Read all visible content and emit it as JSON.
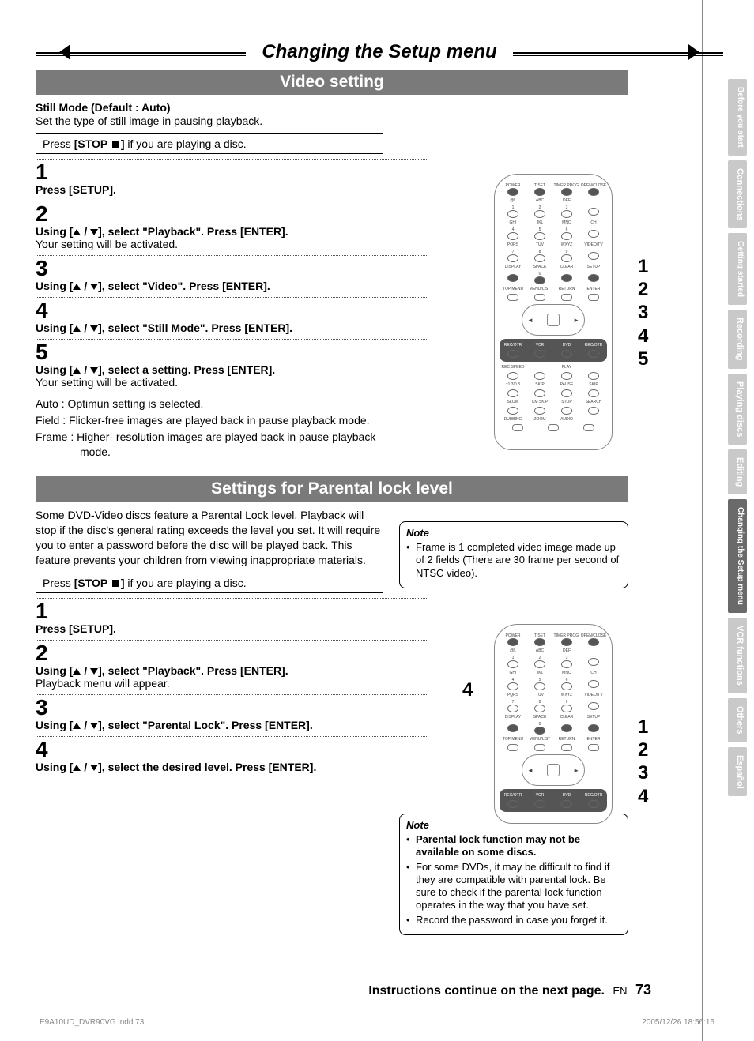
{
  "banner_title": "Changing the Setup menu",
  "section1": {
    "title": "Video setting",
    "heading": "Still Mode (Default : Auto)",
    "desc": "Set the type of still image in pausing playback.",
    "box_pre": "Press ",
    "box_bold": "[STOP ",
    "box_post": " if you are playing a disc.",
    "box_bold_close": "]",
    "steps": [
      {
        "num": "1",
        "bold": "Press [SETUP].",
        "rest": ""
      },
      {
        "num": "2",
        "bold_prefix": "Using [",
        "bold_mid": " / ",
        "bold_suffix": "], select \"Playback\". Press [ENTER].",
        "rest": "Your setting will be activated."
      },
      {
        "num": "3",
        "bold_prefix": "Using [",
        "bold_mid": " / ",
        "bold_suffix": "], select \"Video\". Press [ENTER].",
        "rest": ""
      },
      {
        "num": "4",
        "bold_prefix": "Using [",
        "bold_mid": " / ",
        "bold_suffix": "], select \"Still Mode\". Press [ENTER].",
        "rest": ""
      },
      {
        "num": "5",
        "bold_prefix": "Using [",
        "bold_mid": " / ",
        "bold_suffix": "], select a setting. Press [ENTER].",
        "rest": "Your setting will be activated."
      }
    ],
    "options": [
      "Auto : Optimun setting is selected.",
      "Field : Flicker-free images are played back in pause playback mode.",
      "Frame : Higher- resolution images are played back in pause playback mode."
    ],
    "callouts": [
      "1",
      "2",
      "3",
      "4",
      "5"
    ],
    "note_title": "Note",
    "note_items": [
      "Frame is 1 completed video image made up of 2 fields (There are 30 frame per second of NTSC video)."
    ]
  },
  "section2": {
    "title": "Settings for Parental lock level",
    "intro": "Some DVD-Video discs feature a Parental Lock level. Playback will stop if the disc's general rating exceeds the level you set. It will require you to enter a password before the disc will be played back. This feature prevents your children from viewing inappropriate materials.",
    "box_pre": "Press ",
    "box_bold": "[STOP ",
    "box_bold_close": "]",
    "box_post": " if you are playing a disc.",
    "steps": [
      {
        "num": "1",
        "bold": "Press [SETUP].",
        "rest": ""
      },
      {
        "num": "2",
        "bold_prefix": "Using [",
        "bold_mid": " / ",
        "bold_suffix": "], select \"Playback\". Press [ENTER].",
        "rest": "Playback menu will appear."
      },
      {
        "num": "3",
        "bold_prefix": "Using [",
        "bold_mid": " / ",
        "bold_suffix": "], select \"Parental Lock\". Press [ENTER].",
        "rest": ""
      },
      {
        "num": "4",
        "bold_prefix": "Using [",
        "bold_mid": " / ",
        "bold_suffix": "], select the desired level. Press [ENTER].",
        "rest": ""
      }
    ],
    "callout_left": "4",
    "callouts": [
      "1",
      "2",
      "3",
      "4"
    ],
    "note_title": "Note",
    "note_items": [
      {
        "bold": true,
        "text": "Parental lock function may not be available on some discs."
      },
      {
        "bold": false,
        "text": "For some DVDs, it may be difficult to find if they are compatible with parental lock. Be sure to check if the parental lock function operates in the way that you have set."
      },
      {
        "bold": false,
        "text": "Record the password in case you forget it."
      }
    ]
  },
  "tabs": [
    {
      "label": "Before you start",
      "active": false
    },
    {
      "label": "Connections",
      "active": false
    },
    {
      "label": "Getting started",
      "active": false
    },
    {
      "label": "Recording",
      "active": false
    },
    {
      "label": "Playing discs",
      "active": false
    },
    {
      "label": "Editing",
      "active": false
    },
    {
      "label": "Changing the Setup menu",
      "active": true
    },
    {
      "label": "VCR functions",
      "active": false
    },
    {
      "label": "Others",
      "active": false
    },
    {
      "label": "Español",
      "active": false
    }
  ],
  "remote_labels": {
    "row0": [
      "POWER",
      "T-SET",
      "TIMER PROG.",
      "OPEN/CLOSE"
    ],
    "row1": [
      "@!.",
      "ABC",
      "DEF",
      ""
    ],
    "row1n": [
      "1",
      "2",
      "3",
      ""
    ],
    "row2": [
      "GHI",
      "JKL",
      "MNO",
      "CH"
    ],
    "row2n": [
      "4",
      "5",
      "6",
      ""
    ],
    "row3": [
      "PQRS",
      "TUV",
      "WXYZ",
      "VIDEO/TV"
    ],
    "row3n": [
      "7",
      "8",
      "9",
      ""
    ],
    "row4": [
      "DISPLAY",
      "SPACE",
      "CLEAR",
      "SETUP"
    ],
    "row4n": [
      "",
      "0",
      "",
      ""
    ],
    "row5": [
      "TOP MENU",
      "MENU/LIST",
      "RETURN",
      "ENTER"
    ],
    "row6": [
      "REC/OTR",
      "VCR",
      "DVD",
      "REC/OTR"
    ],
    "row7": [
      "REC SPEED",
      "",
      "PLAY",
      ""
    ],
    "row8": [
      "x1.3/0.8",
      "SKIP",
      "PAUSE",
      "SKIP"
    ],
    "row9": [
      "SLOW",
      "CM SKIP",
      "STOP",
      "SEARCH"
    ],
    "row10": [
      "DUBBING",
      "ZOOM",
      "AUDIO",
      ""
    ]
  },
  "footer": {
    "continue": "Instructions continue on the next page.",
    "lang": "EN",
    "page": "73",
    "file": "E9A10UD_DVR90VG.indd   73",
    "timestamp": "2005/12/26   18:56:16"
  }
}
